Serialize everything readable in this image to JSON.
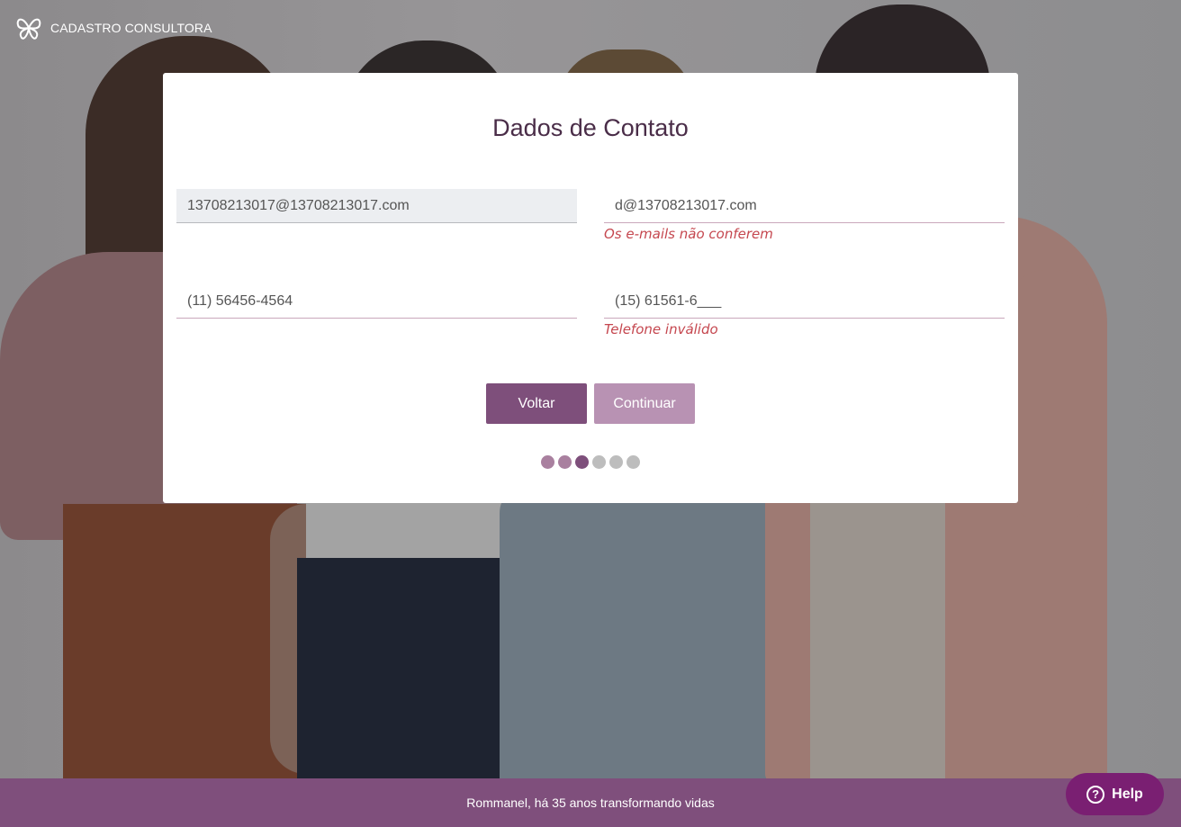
{
  "brand": {
    "title": "CADASTRO CONSULTORA",
    "logo_icon": "butterfly-logo-icon"
  },
  "card": {
    "title": "Dados de Contato",
    "email": {
      "value": "13708213017@13708213017.com"
    },
    "email_confirm": {
      "value": "d@13708213017.com",
      "error": "Os e-mails não conferem"
    },
    "phone": {
      "value": "(11) 56456-4564"
    },
    "phone2": {
      "value": "(15) 61561-6___",
      "error": "Telefone inválido"
    },
    "back_label": "Voltar",
    "continue_label": "Continuar",
    "progress": {
      "total_steps": 6,
      "current_step": 3
    }
  },
  "colors": {
    "brand_purple": "#7e4f7b",
    "button_disabled": "#b892b3",
    "title": "#4a2d48",
    "error": "#c5474f",
    "dot_done": "#a9809f",
    "dot_current": "#7e4f7b",
    "dot_pending": "#bdbdbd",
    "footer": "#7f4f7c",
    "help": "#7a1f72"
  },
  "footer": {
    "text": "Rommanel, há 35 anos transformando vidas"
  },
  "help": {
    "label": "Help",
    "icon": "question-circle-icon"
  }
}
